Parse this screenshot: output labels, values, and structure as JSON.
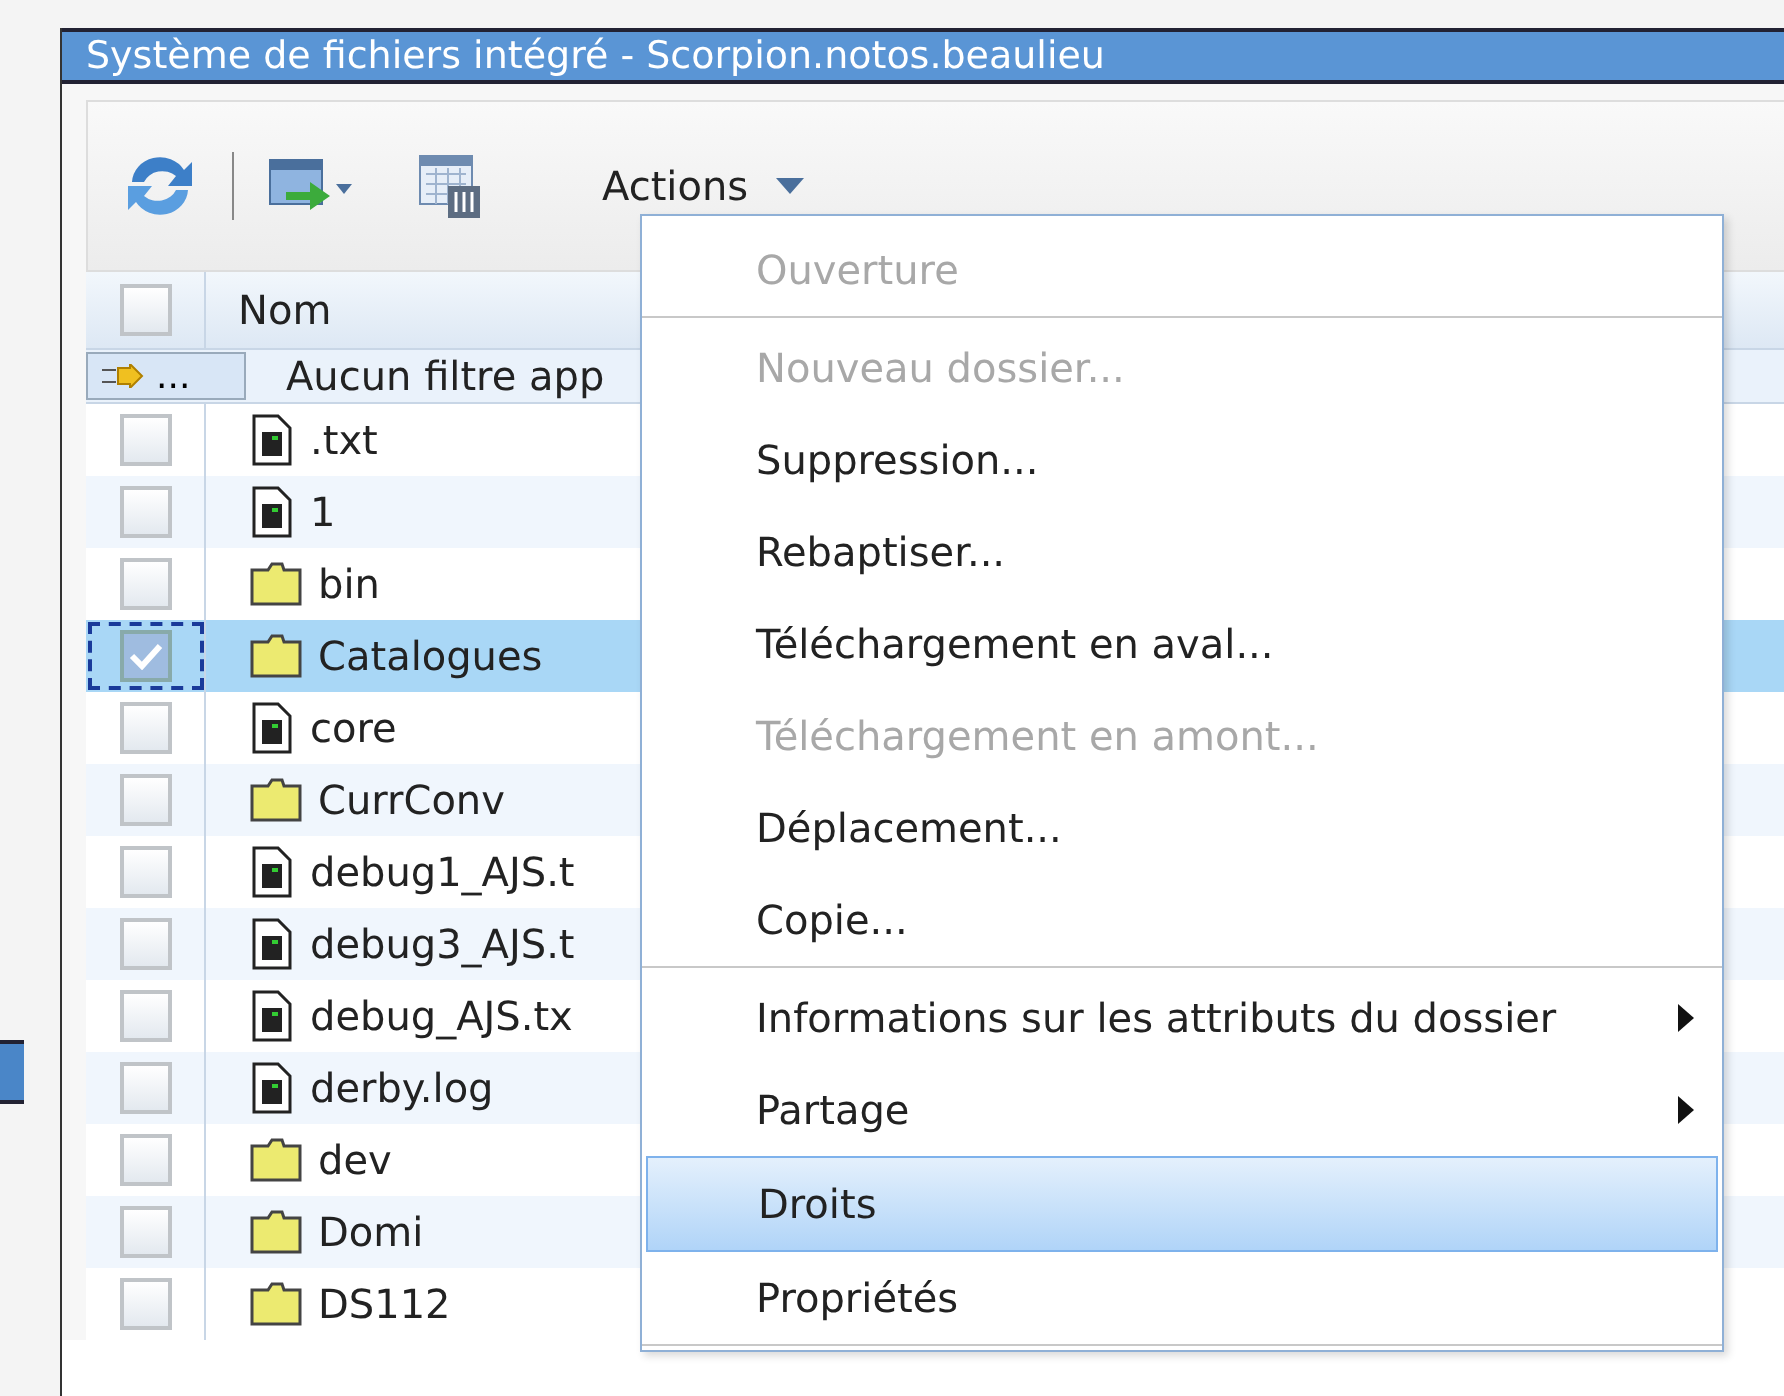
{
  "window": {
    "title": "Système de fichiers intégré - Scorpion.notos.beaulieu"
  },
  "toolbar": {
    "actions_label": "Actions"
  },
  "table": {
    "header": {
      "checked": false,
      "name_column": "Nom"
    },
    "filter": {
      "button": "...",
      "text": "Aucun filtre app"
    },
    "rows": [
      {
        "kind": "file",
        "name": ".txt",
        "checked": false,
        "selected": false
      },
      {
        "kind": "file",
        "name": "1",
        "checked": false,
        "selected": false
      },
      {
        "kind": "folder",
        "name": "bin",
        "checked": false,
        "selected": false
      },
      {
        "kind": "folder",
        "name": "Catalogues",
        "checked": true,
        "selected": true
      },
      {
        "kind": "file",
        "name": "core",
        "checked": false,
        "selected": false
      },
      {
        "kind": "folder",
        "name": "CurrConv",
        "checked": false,
        "selected": false
      },
      {
        "kind": "file",
        "name": "debug1_AJS.t",
        "checked": false,
        "selected": false
      },
      {
        "kind": "file",
        "name": "debug3_AJS.t",
        "checked": false,
        "selected": false
      },
      {
        "kind": "file",
        "name": "debug_AJS.tx",
        "checked": false,
        "selected": false
      },
      {
        "kind": "file",
        "name": "derby.log",
        "checked": false,
        "selected": false
      },
      {
        "kind": "folder",
        "name": "dev",
        "checked": false,
        "selected": false
      },
      {
        "kind": "folder",
        "name": "Domi",
        "checked": false,
        "selected": false
      },
      {
        "kind": "folder",
        "name": "DS112",
        "checked": false,
        "selected": false
      }
    ]
  },
  "menu": {
    "items": [
      {
        "label": "Ouverture",
        "disabled": true,
        "submenu": false,
        "selected": false,
        "separator_after": true
      },
      {
        "label": "Nouveau dossier...",
        "disabled": true,
        "submenu": false,
        "selected": false,
        "separator_after": false
      },
      {
        "label": "Suppression...",
        "disabled": false,
        "submenu": false,
        "selected": false,
        "separator_after": false
      },
      {
        "label": "Rebaptiser...",
        "disabled": false,
        "submenu": false,
        "selected": false,
        "separator_after": false
      },
      {
        "label": "Téléchargement en aval...",
        "disabled": false,
        "submenu": false,
        "selected": false,
        "separator_after": false
      },
      {
        "label": "Téléchargement en amont...",
        "disabled": true,
        "submenu": false,
        "selected": false,
        "separator_after": false
      },
      {
        "label": "Déplacement...",
        "disabled": false,
        "submenu": false,
        "selected": false,
        "separator_after": false
      },
      {
        "label": "Copie...",
        "disabled": false,
        "submenu": false,
        "selected": false,
        "separator_after": true
      },
      {
        "label": "Informations sur les attributs du dossier",
        "disabled": false,
        "submenu": true,
        "selected": false,
        "separator_after": false
      },
      {
        "label": "Partage",
        "disabled": false,
        "submenu": true,
        "selected": false,
        "separator_after": false
      },
      {
        "label": "Droits",
        "disabled": false,
        "submenu": false,
        "selected": true,
        "separator_after": false
      },
      {
        "label": "Propriétés",
        "disabled": false,
        "submenu": false,
        "selected": false,
        "separator_after": true
      }
    ]
  }
}
